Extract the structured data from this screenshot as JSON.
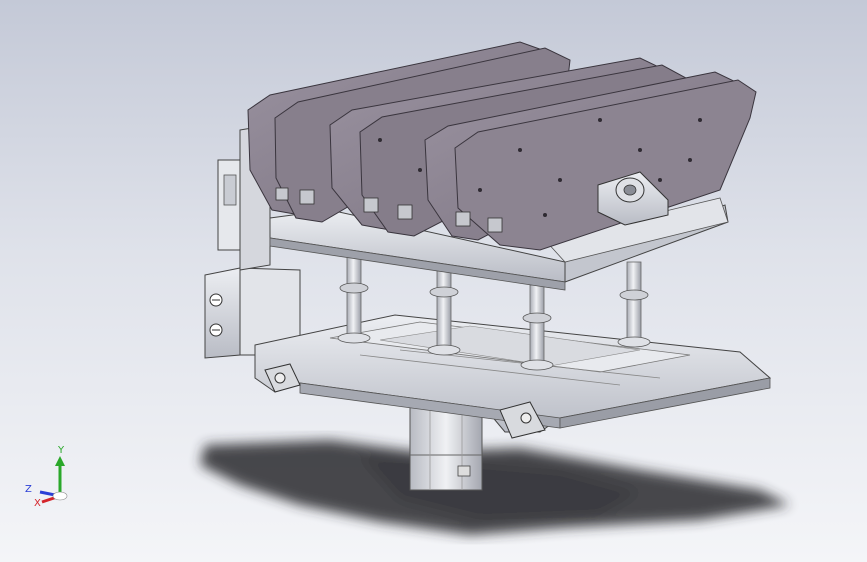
{
  "viewport": {
    "colors": {
      "bg_top": "#c4c9d7",
      "bg_bottom": "#f4f5f8",
      "plate": "#8a828e",
      "plate_dark": "#5d5762",
      "metal": "#d2d4da",
      "metal_dark": "#8d909a",
      "shadow": "#2a2a2e"
    }
  },
  "triad": {
    "x_label": "X",
    "y_label": "Y",
    "z_label": "Z",
    "colors": {
      "x": "#d4252b",
      "y": "#2aa82a",
      "z": "#2b3fd6"
    }
  }
}
